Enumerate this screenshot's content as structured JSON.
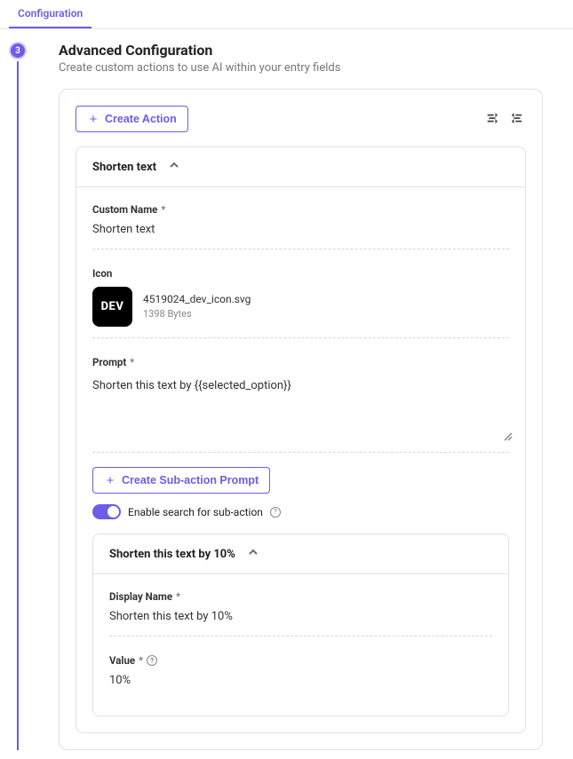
{
  "tab": {
    "label": "Configuration"
  },
  "step": {
    "number": "3"
  },
  "header": {
    "title": "Advanced Configuration",
    "subtitle": "Create custom actions to use AI within your entry fields"
  },
  "buttons": {
    "create_action": "Create Action",
    "create_subaction": "Create Sub-action Prompt"
  },
  "action": {
    "title": "Shorten text",
    "custom_name_label": "Custom Name",
    "custom_name_value": "Shorten text",
    "icon_label": "Icon",
    "icon_filename": "4519024_dev_icon.svg",
    "icon_size": "1398 Bytes",
    "icon_text": "DEV",
    "prompt_label": "Prompt",
    "prompt_value": "Shorten this text by {{selected_option}}"
  },
  "toggle": {
    "label": "Enable search for sub-action"
  },
  "subaction": {
    "title": "Shorten this text by 10%",
    "display_name_label": "Display Name",
    "display_name_value": "Shorten this text by 10%",
    "value_label": "Value",
    "value_value": "10%"
  },
  "asterisk": "*"
}
